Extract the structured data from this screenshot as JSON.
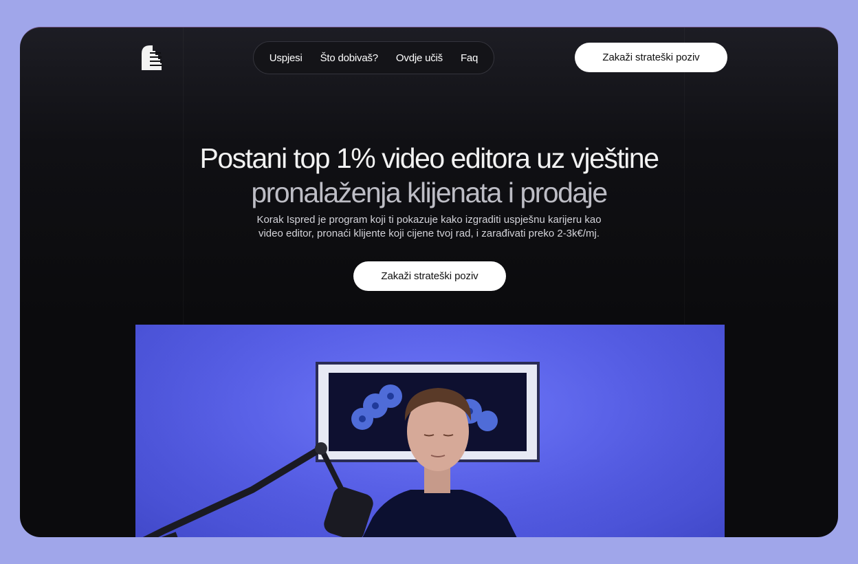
{
  "brand": {
    "logo_icon": "stairs-logo-icon"
  },
  "nav": {
    "items": [
      "Uspjesi",
      "Što dobivaš?",
      "Ovdje učiš",
      "Faq"
    ]
  },
  "header": {
    "cta_label": "Zakaži strateški poziv"
  },
  "hero": {
    "title_line1": "Postani top 1% video editora uz vještine",
    "title_line2": "pronalaženja klijenata i prodaje",
    "subtitle_line1": "Korak Ispred je program koji ti pokazuje kako izgraditi uspješnu karijeru kao",
    "subtitle_line2": "video editor, pronaći klijente koji cijene tvoj rad, i zarađivati preko 2-3k€/mj.",
    "cta_label": "Zakaži strateški poziv"
  },
  "video": {
    "thumbnail_icon": "presenter-video-thumbnail"
  },
  "colors": {
    "page_bg": "#a0a6ea",
    "frame_bg": "#0b0b0d",
    "button_bg": "#ffffff",
    "video_bg": "#5a62ec"
  }
}
